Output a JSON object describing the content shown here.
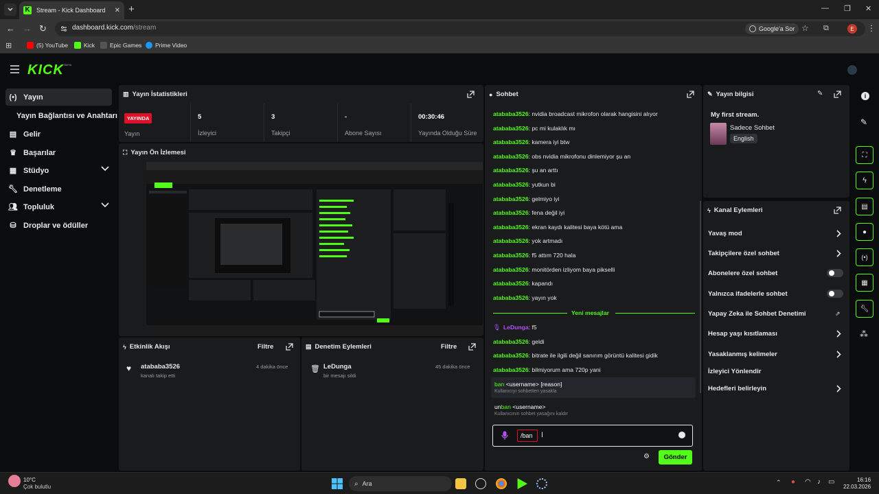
{
  "browser": {
    "tab_title": "Stream - Kick Dashboard",
    "url_host": "dashboard.kick.com",
    "url_path": "/stream",
    "google_btn": "Google'a Sor",
    "profile_letter": "E",
    "bookmarks": [
      "(5) YouTube",
      "Kick",
      "Epic Games",
      "Prime Video"
    ]
  },
  "sidebar": {
    "items": [
      {
        "label": "Yayın"
      },
      {
        "label": "Yayın Bağlantısı ve Anahtarı"
      },
      {
        "label": "Gelir"
      },
      {
        "label": "Başarılar"
      },
      {
        "label": "Stüdyo"
      },
      {
        "label": "Denetleme"
      },
      {
        "label": "Topluluk"
      },
      {
        "label": "Droplar ve ödüller"
      }
    ]
  },
  "stats": {
    "title": "Yayın İstatistikleri",
    "live_badge": "YAYINDA",
    "live_label": "Yayın",
    "viewers_value": "5",
    "viewers_label": "İzleyici",
    "followers_value": "3",
    "followers_label": "Takipçi",
    "subs_value": "-",
    "subs_label": "Abone Sayısı",
    "uptime_value": "00:30:46",
    "uptime_label": "Yayında Olduğu Süre"
  },
  "preview": {
    "title": "Yayın Ön İzlemesi"
  },
  "activity": {
    "title": "Etkinlik Akışı",
    "filter": "Filtre",
    "item_user": "atababa3526",
    "item_desc": "kanalı takip etti",
    "item_time": "4 dakika önce"
  },
  "modlog": {
    "title": "Denetim Eylemleri",
    "filter": "Filtre",
    "item_user": "LeDunga",
    "item_desc": "bir mesajı sildi",
    "item_time": "45 dakika önce"
  },
  "chat": {
    "title": "Sohbet",
    "messages": [
      {
        "user": "atababa3526",
        "text": ": nvidia broadcast mikrofon olarak hangisini alıyor"
      },
      {
        "user": "atababa3526",
        "text": ": pc mi kulaklık mı"
      },
      {
        "user": "atababa3526",
        "text": ": kamera iyi btw"
      },
      {
        "user": "atababa3526",
        "text": ": obs nvidia mikrofonu dinlemiyor şu an"
      },
      {
        "user": "atababa3526",
        "text": ": şu an arttı"
      },
      {
        "user": "atababa3526",
        "text": ": yutkun bi"
      },
      {
        "user": "atababa3526",
        "text": ": gelmiyo iyi"
      },
      {
        "user": "atababa3526",
        "text": ": fena değil iyi"
      },
      {
        "user": "atababa3526",
        "text": ": ekran kaydı kalitesi baya kötü ama"
      },
      {
        "user": "atababa3526",
        "text": ": yok artmadı"
      },
      {
        "user": "atababa3526",
        "text": ": f5 attım 720 hala"
      },
      {
        "user": "atababa3526",
        "text": ": monitörden izliyom baya pikselli"
      },
      {
        "user": "atababa3526",
        "text": ": kapandı"
      },
      {
        "user": "atababa3526",
        "text": ": yayın yok"
      }
    ],
    "new_messages": "Yeni mesajlar",
    "new_list": [
      {
        "user": "LeDunga",
        "text": ": f5"
      },
      {
        "user": "atababa3526",
        "text": ": geldi"
      },
      {
        "user": "atababa3526",
        "text": ": bitrate ile ilgili değil sanırım görüntü kalitesi gidik"
      },
      {
        "user": "atababa3526",
        "text": ": bilmiyorum ama 720p yani"
      }
    ],
    "suggestions": [
      {
        "cmd_hl": "ban",
        "cmd_rest": " <username> [reason]",
        "desc": "Kullanıcıyı sohbetten yasakla"
      },
      {
        "cmd_pre": "un",
        "cmd_hl": "ban",
        "cmd_rest": " <username>",
        "desc": "Kullanıcının sohbet yasağını kaldır"
      }
    ],
    "input_value": "/ban",
    "send": "Gönder"
  },
  "info": {
    "title": "Yayın bilgisi",
    "stream_title": "My first stream.",
    "category": "Sadece Sohbet",
    "language": "English"
  },
  "actions": {
    "title": "Kanal Eylemleri",
    "items": [
      {
        "label": "Yavaş mod",
        "kind": "chevron"
      },
      {
        "label": "Takipçilere özel sohbet",
        "kind": "chevron"
      },
      {
        "label": "Abonelere özel sohbet",
        "kind": "toggle",
        "on": false
      },
      {
        "label": "Yalnızca ifadelerle sohbet",
        "kind": "toggle",
        "on": false
      },
      {
        "label": "Yapay Zeka ile Sohbet Denetimi",
        "kind": "external"
      },
      {
        "label": "Hesap yaşı kısıtlaması",
        "kind": "chevron"
      },
      {
        "label": "Yasaklanmış kelimeler",
        "kind": "chevron"
      },
      {
        "label": "İzleyici Yönlendir",
        "kind": "none"
      },
      {
        "label": "Hedefleri belirleyin",
        "kind": "chevron"
      }
    ]
  },
  "taskbar": {
    "weather_temp": "10°C",
    "weather_desc": "Çok bulutlu",
    "search": "Ara",
    "time": "16:16",
    "date": "22.03.2026"
  },
  "colors": {
    "accent": "#53fc18",
    "live": "#e0102a",
    "panel": "#191b1d",
    "bg": "#0b0c0d"
  }
}
